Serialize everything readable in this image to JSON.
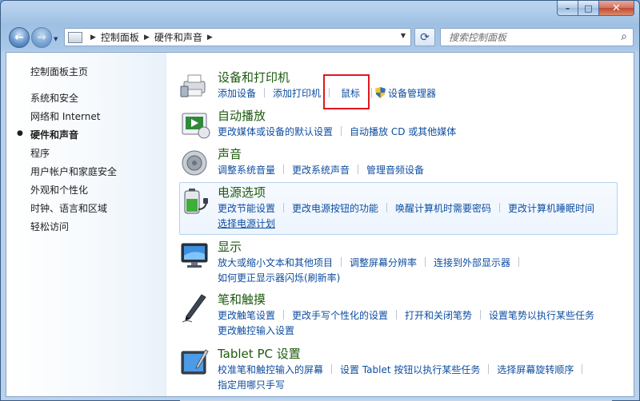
{
  "search": {
    "placeholder": "搜索控制面板"
  },
  "breadcrumb": {
    "root": "控制面板",
    "current": "硬件和声音"
  },
  "sidebar": {
    "home": "控制面板主页",
    "items": [
      {
        "label": "系统和安全"
      },
      {
        "label": "网络和 Internet"
      },
      {
        "label": "硬件和声音",
        "active": true
      },
      {
        "label": "程序"
      },
      {
        "label": "用户帐户和家庭安全"
      },
      {
        "label": "外观和个性化"
      },
      {
        "label": "时钟、语言和区域"
      },
      {
        "label": "轻松访问"
      }
    ]
  },
  "categories": [
    {
      "title": "设备和打印机",
      "icon": "printer-icon",
      "links": [
        "添加设备",
        "添加打印机",
        "鼠标",
        "设备管理器"
      ]
    },
    {
      "title": "自动播放",
      "icon": "autoplay-icon",
      "links": [
        "更改媒体或设备的默认设置",
        "自动播放 CD 或其他媒体"
      ]
    },
    {
      "title": "声音",
      "icon": "speaker-icon",
      "links": [
        "调整系统音量",
        "更改系统声音",
        "管理音频设备"
      ]
    },
    {
      "title": "电源选项",
      "icon": "battery-icon",
      "links": [
        "更改节能设置",
        "更改电源按钮的功能",
        "唤醒计算机时需要密码",
        "更改计算机睡眠时间",
        "选择电源计划"
      ]
    },
    {
      "title": "显示",
      "icon": "monitor-icon",
      "links": [
        "放大或缩小文本和其他项目",
        "调整屏幕分辨率",
        "连接到外部显示器",
        "如何更正显示器闪烁(刷新率)"
      ]
    },
    {
      "title": "笔和触摸",
      "icon": "pen-icon",
      "links": [
        "更改触笔设置",
        "更改手写个性化的设置",
        "打开和关闭笔势",
        "设置笔势以执行某些任务",
        "更改触控输入设置"
      ]
    },
    {
      "title": "Tablet PC 设置",
      "icon": "tablet-icon",
      "links": [
        "校准笔和触控输入的屏幕",
        "设置 Tablet 按钮以执行某些任务",
        "选择屏幕旋转顺序",
        "指定用哪只手写"
      ]
    }
  ],
  "colors": {
    "link": "#0e4da0",
    "category_title": "#1e5a10",
    "highlight": "#e0161e"
  }
}
